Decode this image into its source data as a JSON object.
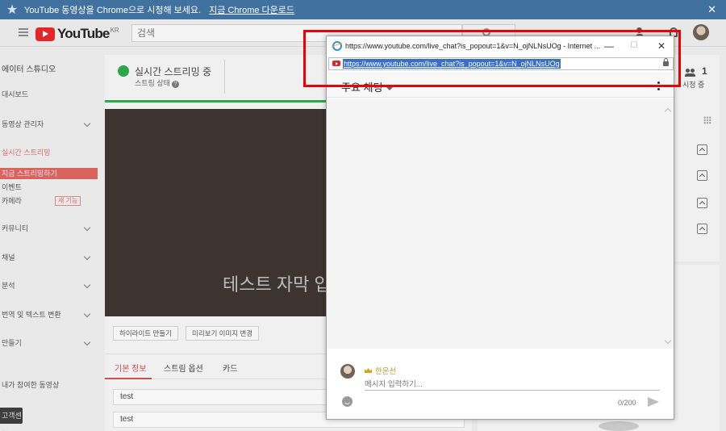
{
  "banner": {
    "text": "YouTube 동영상을 Chrome으로 시청해 보세요.",
    "link": "지금 Chrome 다운로드",
    "close": "✕"
  },
  "masthead": {
    "logo_text": "YouTube",
    "region": "KR",
    "search_placeholder": "검색"
  },
  "sidebar": {
    "studio_title": "에이터 스튜디오",
    "items": [
      {
        "label": "대시보드"
      },
      {
        "label": "동영상 관리자"
      },
      {
        "label": "실시간 스트리밍"
      },
      {
        "label": "지금 스트리밍하기"
      },
      {
        "label": "이벤트"
      },
      {
        "label": "카메라",
        "badge": "새 기능"
      },
      {
        "label": "커뮤니티"
      },
      {
        "label": "채널"
      },
      {
        "label": "분석"
      },
      {
        "label": "번역 및 텍스트 변환"
      },
      {
        "label": "만들기"
      },
      {
        "label": "내가 참여한 동영상"
      }
    ],
    "help_center": "고객센터"
  },
  "main": {
    "status_title": "실시간 스트리밍 중",
    "status_sub": "스트림 상태",
    "caption": "테스트 자막 입",
    "buttons": [
      "하이라이트 만들기",
      "미리보기 이미지 변경"
    ],
    "tabs": [
      "기본 정보",
      "스트림 옵션",
      "카드"
    ],
    "fields": [
      "test",
      "test"
    ]
  },
  "stats": {
    "viewers": "1",
    "viewers_label": "시청 중"
  },
  "popup": {
    "title": "https://www.youtube.com/live_chat?is_popout=1&v=N_ojNLNsUOg - Internet ...",
    "min": "—",
    "max": "☐",
    "close": "✕",
    "url": "https://www.youtube.com/live_chat?is_popout=1&v=N_ojNLNsUOg",
    "chat_title": "주요 채팅",
    "user_name": "한운선",
    "input_placeholder": "메시지 입력하기...",
    "counter": "0/200"
  },
  "colors": {
    "accent_red": "#c9504c",
    "live_green": "#2aa84a",
    "banner_blue": "#41729f",
    "highlight": "#ee0000"
  }
}
